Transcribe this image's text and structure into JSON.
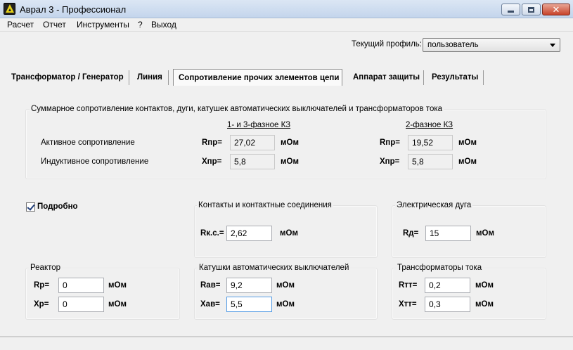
{
  "window": {
    "title": "Аврал 3 - Профессионал"
  },
  "menu": [
    "Расчет",
    "Отчет",
    "Инструменты",
    "?",
    "Выход"
  ],
  "profile": {
    "label": "Текущий профиль:",
    "value": "пользователь"
  },
  "tabs": [
    "Трансформатор / Генератор",
    "Линия",
    "Сопротивление прочих элементов цепи",
    "Аппарат защиты",
    "Результаты"
  ],
  "summary": {
    "title": "Суммарное сопротивление контактов, дуги, катушек автоматических выключателей и трансформаторов тока",
    "col1_header": "1- и 3-фазное КЗ",
    "col2_header": "2-фазное КЗ",
    "active_label": "Активное сопротивление",
    "inductive_label": "Индуктивное сопротивление",
    "r_symbol": "Rпр=",
    "x_symbol": "Xпр=",
    "unit": "мОм",
    "r1": "27,02",
    "x1": "5,8",
    "r2": "19,52",
    "x2": "5,8"
  },
  "detail_checkbox": {
    "label": "Подробно",
    "checked": true
  },
  "contacts": {
    "title": "Контакты и контактные соединения",
    "symbol": "Rк.с.=",
    "value": "2,62",
    "unit": "мОм"
  },
  "arc": {
    "title": "Электрическая дуга",
    "symbol": "Rд=",
    "value": "15",
    "unit": "мОм"
  },
  "reactor": {
    "title": "Реактор",
    "r_symbol": "Rр=",
    "r_value": "0",
    "x_symbol": "Xр=",
    "x_value": "0",
    "unit": "мОм"
  },
  "breaker_coils": {
    "title": "Катушки автоматических выключателей",
    "r_symbol": "Rав=",
    "r_value": "9,2",
    "x_symbol": "Xав=",
    "x_value": "5,5",
    "unit": "мОм"
  },
  "current_transformers": {
    "title": "Трансформаторы тока",
    "r_symbol": "Rтт=",
    "r_value": "0,2",
    "x_symbol": "Xтт=",
    "x_value": "0,3",
    "unit": "мОм"
  }
}
